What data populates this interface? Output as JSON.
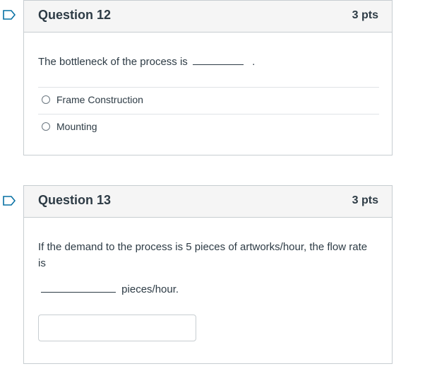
{
  "question12": {
    "title": "Question 12",
    "points": "3 pts",
    "prompt_before": "The bottleneck of the process is",
    "prompt_after": ".",
    "answers": [
      {
        "label": "Frame Construction"
      },
      {
        "label": "Mounting"
      }
    ]
  },
  "question13": {
    "title": "Question 13",
    "points": "3 pts",
    "prompt": "If the demand to the process is 5 pieces of artworks/hour, the flow rate is",
    "unit_suffix": "pieces/hour.",
    "input_value": ""
  },
  "colors": {
    "flag": "#0770a3",
    "header_bg": "#f5f5f5",
    "border": "#c7cdd1",
    "text": "#2d3b45"
  },
  "icons": {
    "flag": "bookmark-flag-icon",
    "radio": "radio-unchecked-icon"
  }
}
